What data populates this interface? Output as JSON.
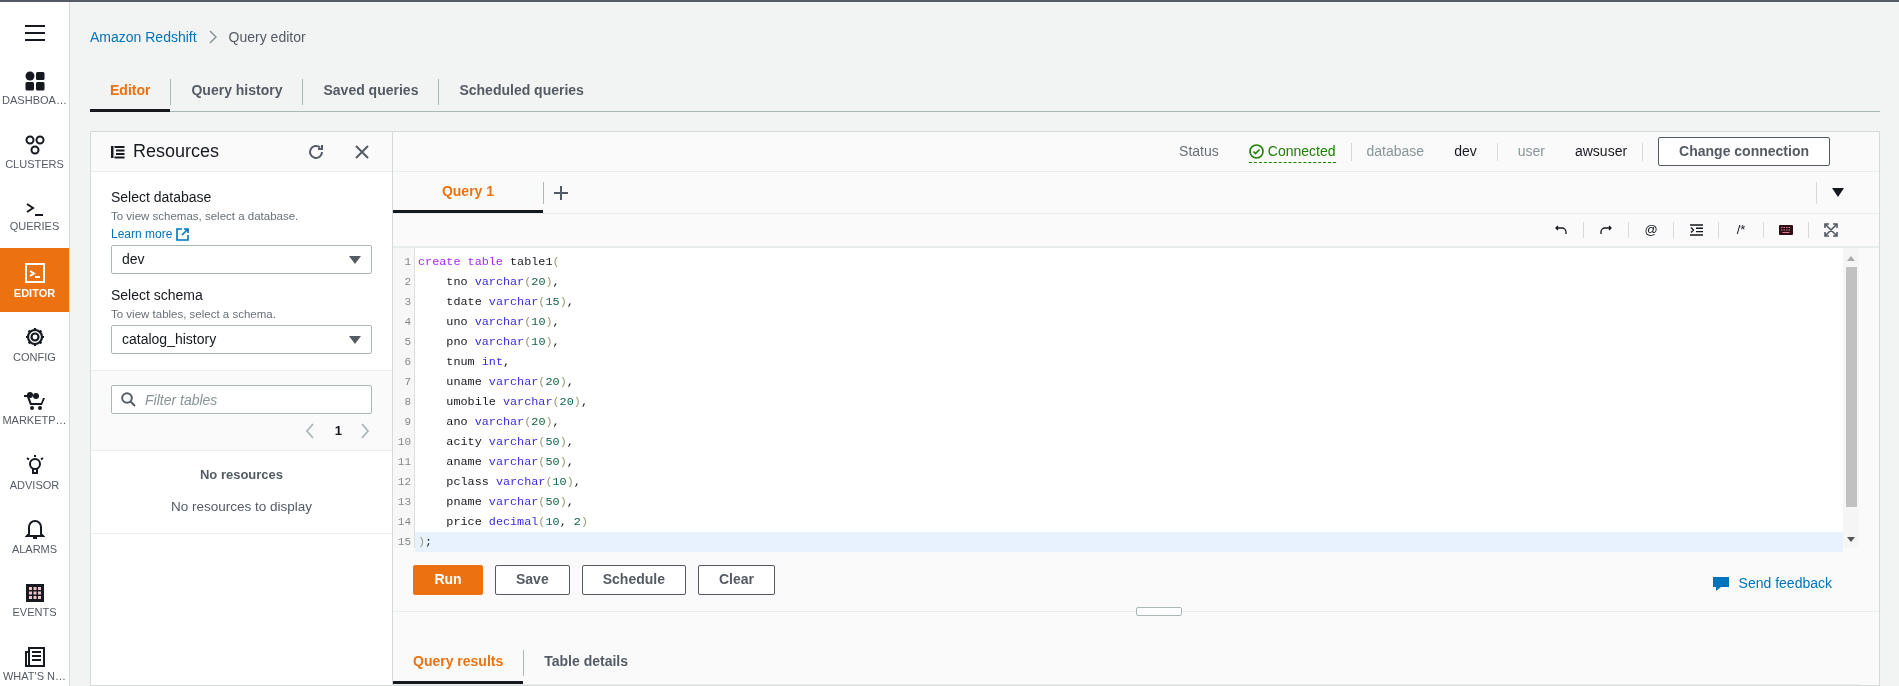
{
  "nav": {
    "items": [
      {
        "label": "DASHBOA…",
        "selected": false
      },
      {
        "label": "CLUSTERS",
        "selected": false
      },
      {
        "label": "QUERIES",
        "selected": false
      },
      {
        "label": "EDITOR",
        "selected": true
      },
      {
        "label": "CONFIG",
        "selected": false
      },
      {
        "label": "MARKETP…",
        "selected": false
      },
      {
        "label": "ADVISOR",
        "selected": false
      },
      {
        "label": "ALARMS",
        "selected": false
      },
      {
        "label": "EVENTS",
        "selected": false
      },
      {
        "label": "WHAT'S N…",
        "selected": false
      }
    ]
  },
  "breadcrumb": [
    {
      "label": "Amazon Redshift",
      "kind": "link"
    },
    {
      "label": "Query editor",
      "kind": "current"
    }
  ],
  "tabs": [
    {
      "label": "Editor",
      "selected": true
    },
    {
      "label": "Query history",
      "selected": false
    },
    {
      "label": "Saved queries",
      "selected": false
    },
    {
      "label": "Scheduled queries",
      "selected": false
    }
  ],
  "resources": {
    "title": "Resources",
    "database": {
      "label": "Select database",
      "hint": "To view schemas, select a database.",
      "link": "Learn more",
      "value": "dev"
    },
    "schema": {
      "label": "Select schema",
      "hint": "To view tables, select a schema.",
      "value": "catalog_history"
    },
    "filter": {
      "placeholder": "Filter tables"
    },
    "page": "1",
    "empty_title": "No resources",
    "empty_message": "No resources to display"
  },
  "connection": {
    "status_label": "Status",
    "status": "Connected",
    "database_label": "database",
    "database": "dev",
    "user_label": "user",
    "user": "awsuser",
    "button": "Change connection"
  },
  "query_tabs": [
    {
      "label": "Query 1",
      "selected": true
    }
  ],
  "toolbar": [
    {
      "kind": "undo"
    },
    {
      "kind": "redo"
    },
    {
      "kind": "glyph",
      "text": "@"
    },
    {
      "kind": "indent"
    },
    {
      "kind": "glyph",
      "text": "/*"
    },
    {
      "kind": "keyboard"
    },
    {
      "kind": "fullscreen"
    }
  ],
  "code": {
    "lines": [
      {
        "number": "1",
        "active": false,
        "tokens": [
          {
            "text": "create table",
            "kind": "keyword"
          },
          {
            "text": " table1",
            "kind": "plain"
          },
          {
            "text": "(",
            "kind": "punct"
          }
        ]
      },
      {
        "number": "2",
        "active": false,
        "tokens": [
          {
            "text": "    tno ",
            "kind": "plain"
          },
          {
            "text": "varchar",
            "kind": "type"
          },
          {
            "text": "(",
            "kind": "punct"
          },
          {
            "text": "20",
            "kind": "number"
          },
          {
            "text": ")",
            "kind": "punct"
          },
          {
            "text": ",",
            "kind": "plain"
          }
        ]
      },
      {
        "number": "3",
        "active": false,
        "tokens": [
          {
            "text": "    tdate ",
            "kind": "plain"
          },
          {
            "text": "varchar",
            "kind": "type"
          },
          {
            "text": "(",
            "kind": "punct"
          },
          {
            "text": "15",
            "kind": "number"
          },
          {
            "text": ")",
            "kind": "punct"
          },
          {
            "text": ",",
            "kind": "plain"
          }
        ]
      },
      {
        "number": "4",
        "active": false,
        "tokens": [
          {
            "text": "    uno ",
            "kind": "plain"
          },
          {
            "text": "varchar",
            "kind": "type"
          },
          {
            "text": "(",
            "kind": "punct"
          },
          {
            "text": "10",
            "kind": "number"
          },
          {
            "text": ")",
            "kind": "punct"
          },
          {
            "text": ",",
            "kind": "plain"
          }
        ]
      },
      {
        "number": "5",
        "active": false,
        "tokens": [
          {
            "text": "    pno ",
            "kind": "plain"
          },
          {
            "text": "varchar",
            "kind": "type"
          },
          {
            "text": "(",
            "kind": "punct"
          },
          {
            "text": "10",
            "kind": "number"
          },
          {
            "text": ")",
            "kind": "punct"
          },
          {
            "text": ",",
            "kind": "plain"
          }
        ]
      },
      {
        "number": "6",
        "active": false,
        "tokens": [
          {
            "text": "    tnum ",
            "kind": "plain"
          },
          {
            "text": "int",
            "kind": "type"
          },
          {
            "text": ",",
            "kind": "plain"
          }
        ]
      },
      {
        "number": "7",
        "active": false,
        "tokens": [
          {
            "text": "    uname ",
            "kind": "plain"
          },
          {
            "text": "varchar",
            "kind": "type"
          },
          {
            "text": "(",
            "kind": "punct"
          },
          {
            "text": "20",
            "kind": "number"
          },
          {
            "text": ")",
            "kind": "punct"
          },
          {
            "text": ",",
            "kind": "plain"
          }
        ]
      },
      {
        "number": "8",
        "active": false,
        "tokens": [
          {
            "text": "    umobile ",
            "kind": "plain"
          },
          {
            "text": "varchar",
            "kind": "type"
          },
          {
            "text": "(",
            "kind": "punct"
          },
          {
            "text": "20",
            "kind": "number"
          },
          {
            "text": ")",
            "kind": "punct"
          },
          {
            "text": ",",
            "kind": "plain"
          }
        ]
      },
      {
        "number": "9",
        "active": false,
        "tokens": [
          {
            "text": "    ano ",
            "kind": "plain"
          },
          {
            "text": "varchar",
            "kind": "type"
          },
          {
            "text": "(",
            "kind": "punct"
          },
          {
            "text": "20",
            "kind": "number"
          },
          {
            "text": ")",
            "kind": "punct"
          },
          {
            "text": ",",
            "kind": "plain"
          }
        ]
      },
      {
        "number": "10",
        "active": false,
        "tokens": [
          {
            "text": "    acity ",
            "kind": "plain"
          },
          {
            "text": "varchar",
            "kind": "type"
          },
          {
            "text": "(",
            "kind": "punct"
          },
          {
            "text": "50",
            "kind": "number"
          },
          {
            "text": ")",
            "kind": "punct"
          },
          {
            "text": ",",
            "kind": "plain"
          }
        ]
      },
      {
        "number": "11",
        "active": false,
        "tokens": [
          {
            "text": "    aname ",
            "kind": "plain"
          },
          {
            "text": "varchar",
            "kind": "type"
          },
          {
            "text": "(",
            "kind": "punct"
          },
          {
            "text": "50",
            "kind": "number"
          },
          {
            "text": ")",
            "kind": "punct"
          },
          {
            "text": ",",
            "kind": "plain"
          }
        ]
      },
      {
        "number": "12",
        "active": false,
        "tokens": [
          {
            "text": "    pclass ",
            "kind": "plain"
          },
          {
            "text": "varchar",
            "kind": "type"
          },
          {
            "text": "(",
            "kind": "punct"
          },
          {
            "text": "10",
            "kind": "number"
          },
          {
            "text": ")",
            "kind": "punct"
          },
          {
            "text": ",",
            "kind": "plain"
          }
        ]
      },
      {
        "number": "13",
        "active": false,
        "tokens": [
          {
            "text": "    pname ",
            "kind": "plain"
          },
          {
            "text": "varchar",
            "kind": "type"
          },
          {
            "text": "(",
            "kind": "punct"
          },
          {
            "text": "50",
            "kind": "number"
          },
          {
            "text": ")",
            "kind": "punct"
          },
          {
            "text": ",",
            "kind": "plain"
          }
        ]
      },
      {
        "number": "14",
        "active": false,
        "tokens": [
          {
            "text": "    price ",
            "kind": "plain"
          },
          {
            "text": "decimal",
            "kind": "type"
          },
          {
            "text": "(",
            "kind": "punct"
          },
          {
            "text": "10",
            "kind": "number"
          },
          {
            "text": ", ",
            "kind": "plain"
          },
          {
            "text": "2",
            "kind": "number"
          },
          {
            "text": ")",
            "kind": "punct"
          }
        ]
      },
      {
        "number": "15",
        "active": true,
        "tokens": [
          {
            "text": ")",
            "kind": "punct"
          },
          {
            "text": ";",
            "kind": "plain"
          }
        ]
      }
    ]
  },
  "actions": [
    {
      "label": "Run",
      "primary": true
    },
    {
      "label": "Save",
      "primary": false
    },
    {
      "label": "Schedule",
      "primary": false
    },
    {
      "label": "Clear",
      "primary": false
    }
  ],
  "feedback": "Send feedback",
  "result_tabs": [
    {
      "label": "Query results",
      "selected": true
    },
    {
      "label": "Table details",
      "selected": false
    }
  ]
}
